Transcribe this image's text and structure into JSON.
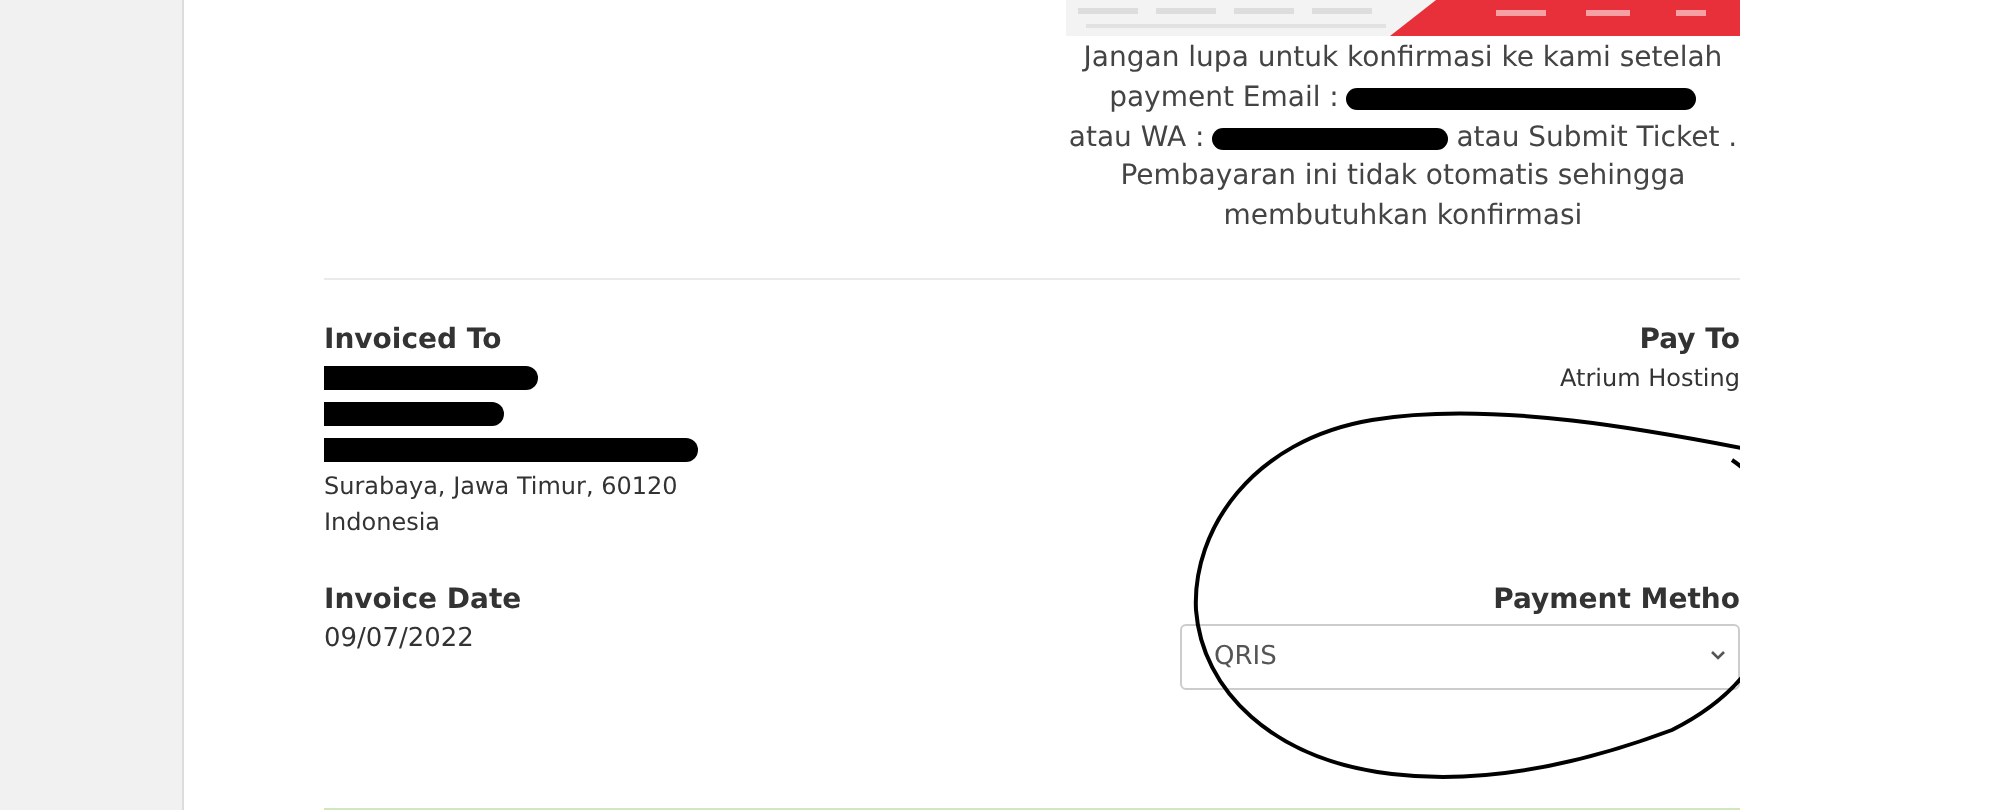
{
  "banner": {
    "kind": "picture"
  },
  "notice": [
    [
      {
        "kind": "text",
        "text": "Jangan lupa untuk konfirmasi ke kami setelah"
      }
    ],
    [
      {
        "kind": "text",
        "text": "payment Email :"
      },
      {
        "kind": "redaction"
      }
    ],
    [
      {
        "kind": "text",
        "text": "atau WA :"
      },
      {
        "kind": "redaction"
      },
      {
        "kind": "text",
        "text": "atau Submit Ticket ."
      }
    ],
    [
      {
        "kind": "text",
        "text": "Pembayaran ini tidak otomatis sehingga"
      }
    ],
    [
      {
        "kind": "text",
        "text": "membutuhkan konfirmasi"
      }
    ]
  ],
  "invoiced_to": {
    "heading": "Invoiced To",
    "lines": [
      {
        "kind": "redaction"
      },
      {
        "kind": "redaction"
      },
      {
        "kind": "redaction"
      },
      {
        "kind": "text",
        "text": "Surabaya, Jawa Timur, 60120"
      },
      {
        "kind": "text",
        "text": "Indonesia"
      }
    ]
  },
  "pay_to": {
    "heading": "Pay To",
    "lines": [
      "Atrium Hosting"
    ]
  },
  "invoice_date": {
    "heading": "Invoice Date",
    "value": "09/07/2022"
  },
  "payment_method": {
    "heading": "Payment Metho",
    "value": "QRIS"
  },
  "annotation": {
    "kind": "circle"
  }
}
